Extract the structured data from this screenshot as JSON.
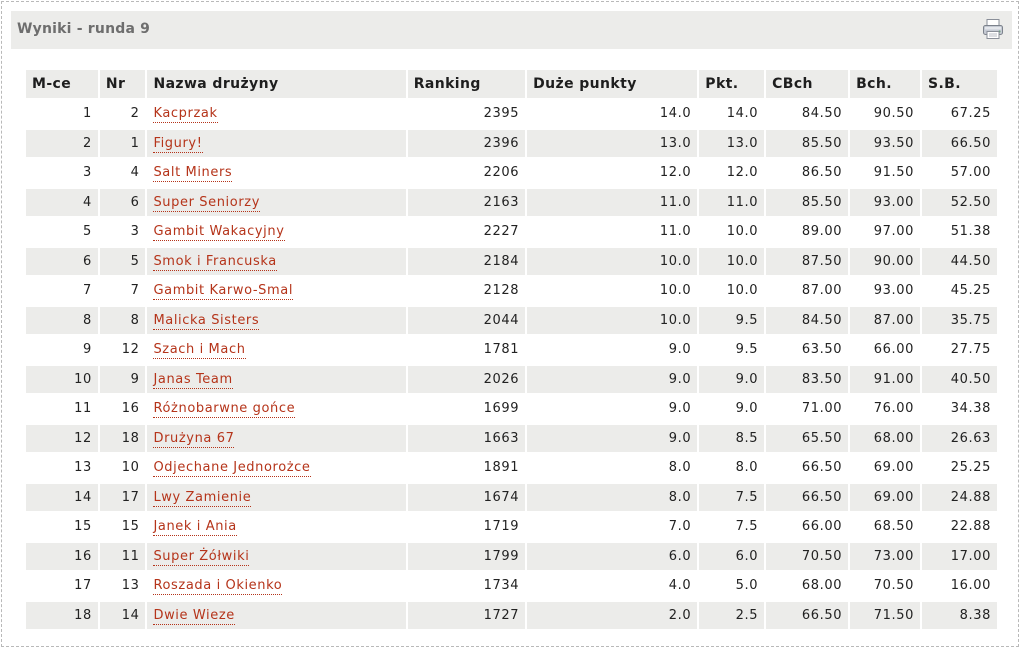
{
  "header": {
    "title": "Wyniki - runda 9",
    "print_icon": "printer-icon"
  },
  "colors": {
    "link": "#b5341a",
    "header_bg": "#ececea",
    "row_alt_bg": "#ececea"
  },
  "table": {
    "columns": [
      "M-ce",
      "Nr",
      "Nazwa drużyny",
      "Ranking",
      "Duże punkty",
      "Pkt.",
      "CBch",
      "Bch.",
      "S.B."
    ],
    "rows": [
      [
        "1",
        "2",
        "Kacprzak",
        "2395",
        "14.0",
        "14.0",
        "84.50",
        "90.50",
        "67.25"
      ],
      [
        "2",
        "1",
        "Figury!",
        "2396",
        "13.0",
        "13.0",
        "85.50",
        "93.50",
        "66.50"
      ],
      [
        "3",
        "4",
        "Salt Miners",
        "2206",
        "12.0",
        "12.0",
        "86.50",
        "91.50",
        "57.00"
      ],
      [
        "4",
        "6",
        "Super Seniorzy",
        "2163",
        "11.0",
        "11.0",
        "85.50",
        "93.00",
        "52.50"
      ],
      [
        "5",
        "3",
        "Gambit Wakacyjny",
        "2227",
        "11.0",
        "10.0",
        "89.00",
        "97.00",
        "51.38"
      ],
      [
        "6",
        "5",
        "Smok i Francuska",
        "2184",
        "10.0",
        "10.0",
        "87.50",
        "90.00",
        "44.50"
      ],
      [
        "7",
        "7",
        "Gambit Karwo-Smal",
        "2128",
        "10.0",
        "10.0",
        "87.00",
        "93.00",
        "45.25"
      ],
      [
        "8",
        "8",
        "Malicka Sisters",
        "2044",
        "10.0",
        "9.5",
        "84.50",
        "87.00",
        "35.75"
      ],
      [
        "9",
        "12",
        "Szach i Mach",
        "1781",
        "9.0",
        "9.5",
        "63.50",
        "66.00",
        "27.75"
      ],
      [
        "10",
        "9",
        "Janas Team",
        "2026",
        "9.0",
        "9.0",
        "83.50",
        "91.00",
        "40.50"
      ],
      [
        "11",
        "16",
        "Różnobarwne gońce",
        "1699",
        "9.0",
        "9.0",
        "71.00",
        "76.00",
        "34.38"
      ],
      [
        "12",
        "18",
        "Drużyna 67",
        "1663",
        "9.0",
        "8.5",
        "65.50",
        "68.00",
        "26.63"
      ],
      [
        "13",
        "10",
        "Odjechane Jednorożce",
        "1891",
        "8.0",
        "8.0",
        "66.50",
        "69.00",
        "25.25"
      ],
      [
        "14",
        "17",
        "Lwy Zamienie",
        "1674",
        "8.0",
        "7.5",
        "66.50",
        "69.00",
        "24.88"
      ],
      [
        "15",
        "15",
        "Janek i Ania",
        "1719",
        "7.0",
        "7.5",
        "66.00",
        "68.50",
        "22.88"
      ],
      [
        "16",
        "11",
        "Super Żółwiki",
        "1799",
        "6.0",
        "6.0",
        "70.50",
        "73.00",
        "17.00"
      ],
      [
        "17",
        "13",
        "Roszada i Okienko",
        "1734",
        "4.0",
        "5.0",
        "68.00",
        "70.50",
        "16.00"
      ],
      [
        "18",
        "14",
        "Dwie Wieze",
        "1727",
        "2.0",
        "2.5",
        "66.50",
        "71.50",
        "8.38"
      ]
    ]
  }
}
